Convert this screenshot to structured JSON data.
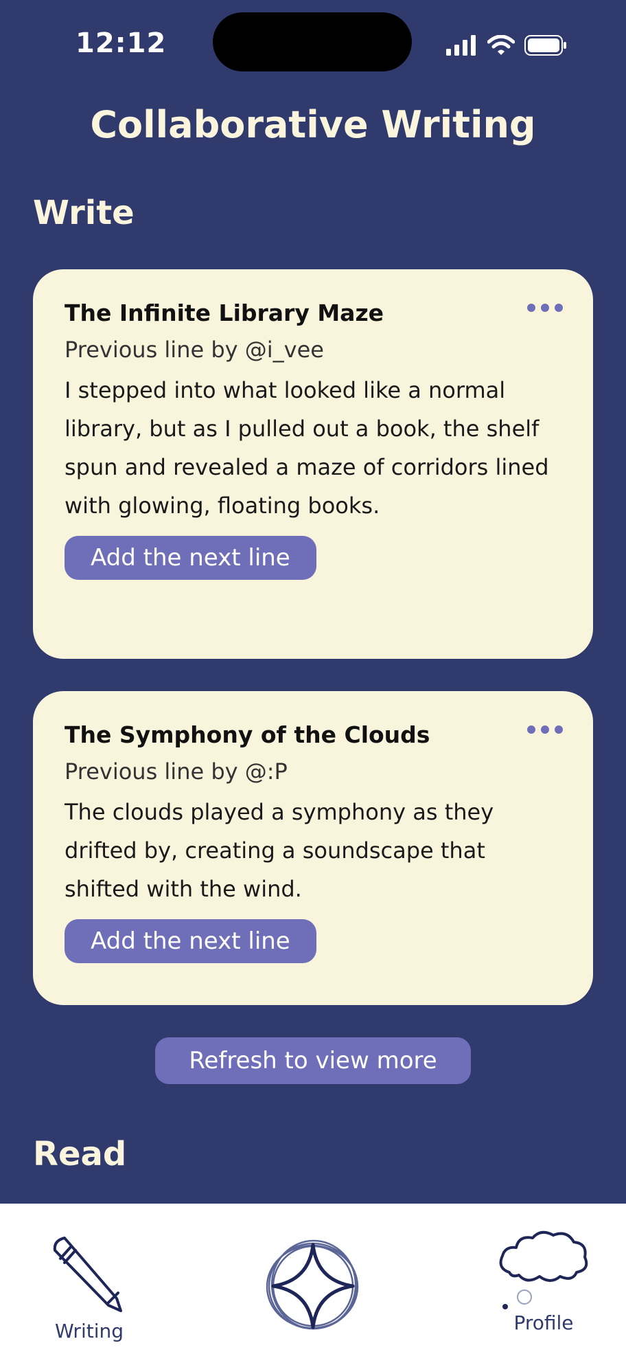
{
  "status_bar": {
    "time": "12:12",
    "icons": [
      "signal-icon",
      "wifi-icon",
      "battery-icon"
    ]
  },
  "header": {
    "title": "Collaborative Writing"
  },
  "sections": {
    "write": "Write",
    "read": "Read"
  },
  "cards": [
    {
      "title": "The Infinite Library Maze",
      "previous_line": "Previous line by @i_vee",
      "text": "I stepped into what looked like a normal library, but as I pulled out a book, the shelf spun and revealed a maze of corridors lined with glowing, floating books.",
      "button_label": "Add the next line"
    },
    {
      "title": "The Symphony of the Clouds",
      "previous_line": "Previous line by @:P",
      "text": "The clouds played a symphony as they drifted by, creating a soundscape that shifted with the wind.",
      "button_label": "Add the next line"
    }
  ],
  "refresh_label": "Refresh to view more",
  "bottom_nav": {
    "writing_label": "Writing",
    "profile_label": "Profile",
    "icons": [
      "pencil-icon",
      "star-compass-icon",
      "cloud-icon"
    ]
  },
  "colors": {
    "background": "#303a6d",
    "card": "#f9f5dd",
    "accent": "#6f6fb9",
    "title_text": "#faf5dc"
  }
}
